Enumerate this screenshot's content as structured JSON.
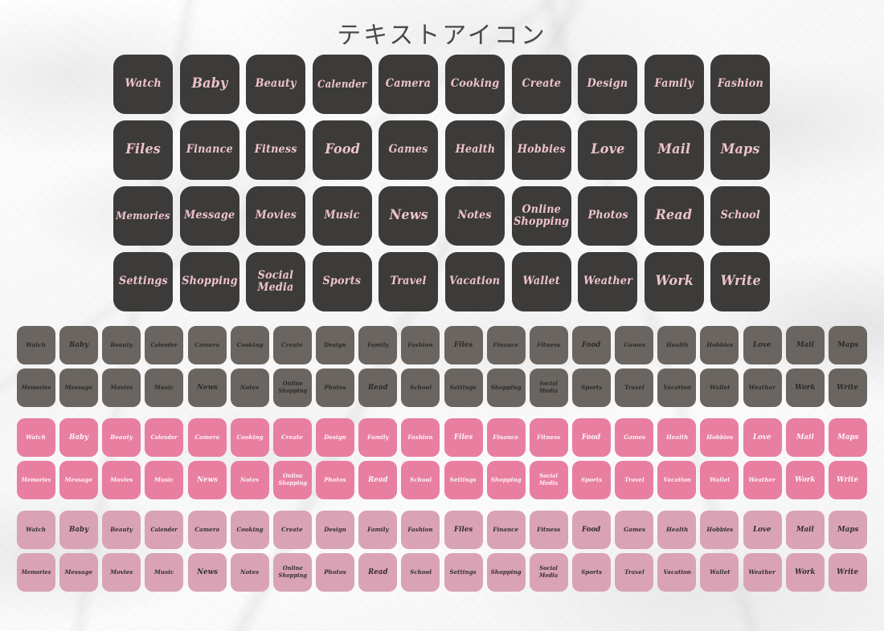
{
  "page": {
    "title": "テキストアイコン",
    "background": "white-marble-texture"
  },
  "colors": {
    "dark_tile": "#3c3b39",
    "dark_tile_text": "#eec2cf",
    "gray_tile": "#6a6560",
    "gray_tile_text": "#2c2a29",
    "pink_tile": "#e87fa0",
    "pink_tile_text": "#fdf4f7",
    "dusty_tile": "#d9a3b5",
    "dusty_tile_text": "#332f31",
    "title_text": "#4a4a4a",
    "page_background": "#fafafa"
  },
  "labels": [
    "Watch",
    "Baby",
    "Beauty",
    "Calender",
    "Camera",
    "Cooking",
    "Create",
    "Design",
    "Family",
    "Fashion",
    "Files",
    "Finance",
    "Fitness",
    "Food",
    "Games",
    "Health",
    "Hobbies",
    "Love",
    "Mail",
    "Maps",
    "Memories",
    "Message",
    "Movies",
    "Music",
    "News",
    "Notes",
    "Online\nShopping",
    "Photos",
    "Read",
    "School",
    "Settings",
    "Shopping",
    "Social\nMedia",
    "Sports",
    "Travel",
    "Vacation",
    "Wallet",
    "Weather",
    "Work",
    "Write"
  ],
  "large_grid": {
    "columns": 10,
    "rows": 4,
    "variant": "dark",
    "rows_data": [
      [
        "Watch",
        "Baby",
        "Beauty",
        "Calender",
        "Camera",
        "Cooking",
        "Create",
        "Design",
        "Family",
        "Fashion"
      ],
      [
        "Files",
        "Finance",
        "Fitness",
        "Food",
        "Games",
        "Health",
        "Hobbies",
        "Love",
        "Mail",
        "Maps"
      ],
      [
        "Memories",
        "Message",
        "Movies",
        "Music",
        "News",
        "Notes",
        "Online\nShopping",
        "Photos",
        "Read",
        "School"
      ],
      [
        "Settings",
        "Shopping",
        "Social\nMedia",
        "Sports",
        "Travel",
        "Vacation",
        "Wallet",
        "Weather",
        "Work",
        "Write"
      ]
    ]
  },
  "bands": [
    {
      "id": "gray",
      "variant": "v-gray",
      "columns": 20,
      "rows": 2
    },
    {
      "id": "pink",
      "variant": "v-pink",
      "columns": 20,
      "rows": 2
    },
    {
      "id": "dusty",
      "variant": "v-dusty",
      "columns": 20,
      "rows": 2
    }
  ],
  "size_overrides": {
    "Calender": "s-xs",
    "Cooking": "s-sm",
    "Memories": "s-xs",
    "Message": "s-sm",
    "Shopping": "s-sm",
    "Vacation": "s-sm",
    "Finance": "s-sm",
    "Fitness": "s-sm",
    "Hobbies": "s-sm",
    "Settings": "s-sm",
    "Weather": "s-sm",
    "Fashion": "s-sm",
    "Food": "s-lg",
    "Love": "s-lg",
    "Read": "s-lg",
    "News": "s-lg",
    "Baby": "s-lg",
    "Music": "s-sm",
    "Photos": "s-sm",
    "Movies": "s-sm",
    "School": "s-sm",
    "Sports": "s-sm",
    "Travel": "s-sm",
    "Wallet": "s-sm",
    "Health": "s-sm",
    "Games": "s-sm",
    "Beauty": "s-sm",
    "Camera": "s-sm",
    "Design": "s-sm",
    "Family": "s-sm",
    "Write": "s-lg",
    "Work": "s-lg",
    "Mail": "s-lg",
    "Maps": "s-lg",
    "Files": "s-lg",
    "Notes": "s-sm",
    "Watch": "s-sm",
    "Create": "s-sm"
  }
}
